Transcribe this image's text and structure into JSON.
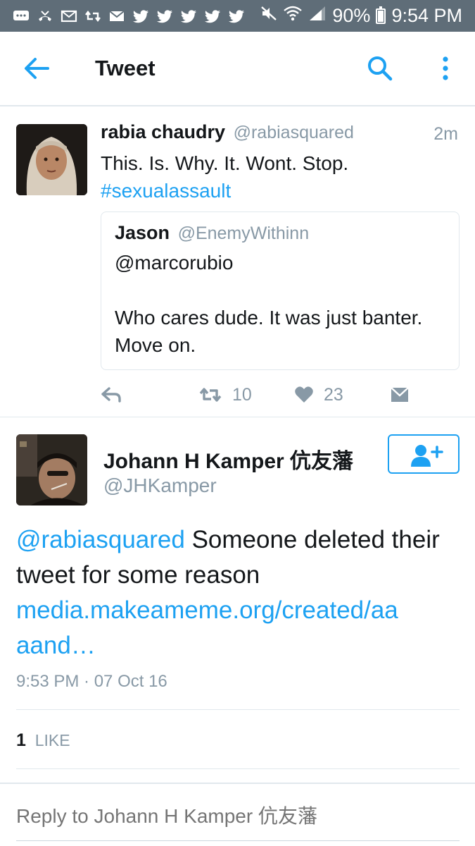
{
  "status_bar": {
    "battery": "90%",
    "time": "9:54 PM",
    "icons": [
      "chat-bubble-icon",
      "missed-call-icon",
      "mail-icon",
      "retweet-icon",
      "mail-icon",
      "twitter-icon",
      "twitter-icon",
      "twitter-icon",
      "twitter-icon",
      "twitter-icon",
      "mute-icon",
      "wifi-icon",
      "signal-icon",
      "battery-icon"
    ]
  },
  "header": {
    "title": "Tweet"
  },
  "quoted_parent": {
    "name": "rabia chaudry",
    "handle": "@rabiasquared",
    "time": "2m",
    "text": "This. Is. Why. It. Wont. Stop.",
    "hashtag": "#sexualassault",
    "quote": {
      "name": "Jason",
      "handle": "@EnemyWithinn",
      "line1": "@marcorubio",
      "line2": "Who cares dude. It was just banter. Move on."
    },
    "retweets": "10",
    "likes": "23"
  },
  "focused_tweet": {
    "name": "Johann H Kamper 伉友藩",
    "handle": "@JHKamper",
    "mention": "@rabiasquared",
    "text": " Someone deleted their tweet for some reason",
    "link": "media.makeameme.org/created/aaaand…",
    "timestamp": "9:53 PM · 07 Oct 16",
    "like_count": "1",
    "like_label": "LIKE"
  },
  "reply": {
    "placeholder": "Reply to Johann H Kamper 伉友藩"
  },
  "colors": {
    "accent": "#1da1f2",
    "status_bar": "#5f6d78",
    "muted": "#8899a6"
  }
}
